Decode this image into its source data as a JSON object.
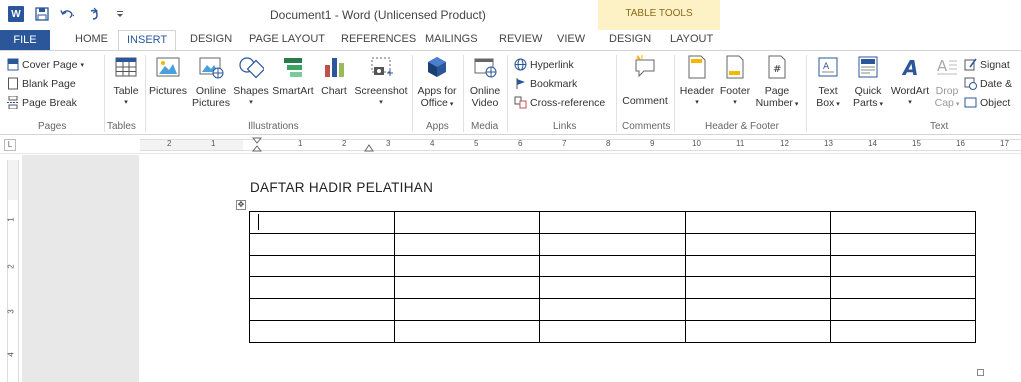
{
  "titlebar": {
    "document_title": "Document1 - Word (Unlicensed Product)",
    "contextual_group": "TABLE TOOLS",
    "qat": {
      "logo": "W"
    }
  },
  "tabs": [
    {
      "label": "FILE"
    },
    {
      "label": "HOME"
    },
    {
      "label": "INSERT"
    },
    {
      "label": "DESIGN"
    },
    {
      "label": "PAGE LAYOUT"
    },
    {
      "label": "REFERENCES"
    },
    {
      "label": "MAILINGS"
    },
    {
      "label": "REVIEW"
    },
    {
      "label": "VIEW"
    },
    {
      "label": "DESIGN"
    },
    {
      "label": "LAYOUT"
    }
  ],
  "ribbon": {
    "pages": {
      "label": "Pages",
      "cover_page": "Cover Page",
      "blank_page": "Blank Page",
      "page_break": "Page Break"
    },
    "tables": {
      "label": "Tables",
      "table": "Table"
    },
    "illustrations": {
      "label": "Illustrations",
      "pictures": "Pictures",
      "online_pictures_1": "Online",
      "online_pictures_2": "Pictures",
      "shapes": "Shapes",
      "smartart": "SmartArt",
      "chart": "Chart",
      "screenshot": "Screenshot"
    },
    "apps": {
      "label": "Apps",
      "apps_1": "Apps for",
      "apps_2": "Office"
    },
    "media": {
      "label": "Media",
      "video_1": "Online",
      "video_2": "Video"
    },
    "links": {
      "label": "Links",
      "hyperlink": "Hyperlink",
      "bookmark": "Bookmark",
      "cross_reference": "Cross-reference"
    },
    "comments": {
      "label": "Comments",
      "comment": "Comment"
    },
    "header_footer": {
      "label": "Header & Footer",
      "header": "Header",
      "footer": "Footer",
      "page_number_1": "Page",
      "page_number_2": "Number"
    },
    "text": {
      "label": "Text",
      "textbox_1": "Text",
      "textbox_2": "Box",
      "quick_parts_1": "Quick",
      "quick_parts_2": "Parts",
      "wordart": "WordArt",
      "dropcap_1": "Drop",
      "dropcap_2": "Cap",
      "signature": "Signat",
      "date_time": "Date &",
      "object": "Object"
    }
  },
  "ruler": {
    "corner": "L",
    "numbers": [
      "2",
      "1",
      "1",
      "2",
      "3",
      "4",
      "5",
      "6",
      "7",
      "8",
      "9",
      "10",
      "11",
      "12",
      "13",
      "14",
      "15",
      "16",
      "17"
    ],
    "vertical_numbers": [
      "1",
      "2",
      "3",
      "4"
    ]
  },
  "document": {
    "heading": "DAFTAR HADIR PELATIHAN",
    "table": {
      "rows": 6,
      "cols": 5
    }
  },
  "colors": {
    "accent": "#2b579a",
    "contextual": "#fdf2c6"
  }
}
